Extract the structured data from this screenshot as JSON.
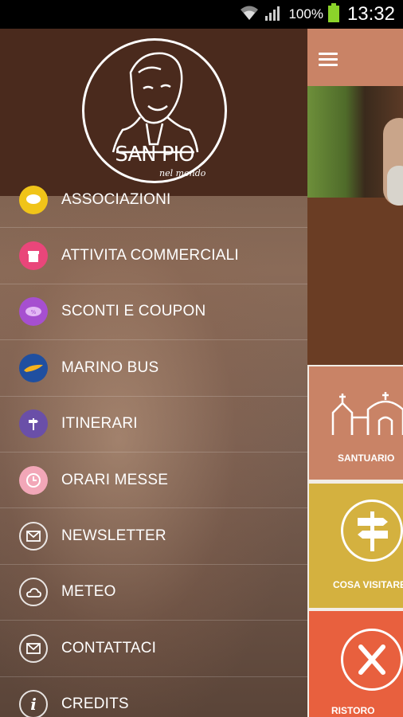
{
  "status_bar": {
    "battery_pct": "100%",
    "time": "13:32",
    "icons": [
      "wifi-icon",
      "signal-icon",
      "battery-icon"
    ]
  },
  "drawer": {
    "logo": {
      "title": "SAN PIO",
      "subtitle": "nel mondo"
    },
    "items": [
      {
        "label": "ASSOCIAZIONI",
        "icon": "chat-bubble-icon",
        "color": "#f0c419"
      },
      {
        "label": "ATTIVITA COMMERCIALI",
        "icon": "shop-icon",
        "color": "#e9467a"
      },
      {
        "label": "SCONTI E COUPON",
        "icon": "coupon-icon",
        "color": "#a64fd0"
      },
      {
        "label": "MARINO BUS",
        "icon": "bus-icon",
        "color": "#1f4fa0"
      },
      {
        "label": "ITINERARI",
        "icon": "signpost-icon",
        "color": "#6a4fa8"
      },
      {
        "label": "ORARI MESSE",
        "icon": "clock-icon",
        "color": "#f2a7b8"
      },
      {
        "label": "NEWSLETTER",
        "icon": "mail-icon",
        "color": "#ffffff"
      },
      {
        "label": "METEO",
        "icon": "weather-icon",
        "color": "#ffffff"
      },
      {
        "label": "CONTATTACI",
        "icon": "envelope-icon",
        "color": "#ffffff"
      },
      {
        "label": "CREDITS",
        "icon": "info-icon",
        "color": "#ffffff"
      }
    ]
  },
  "main": {
    "tiles": [
      {
        "label": "SANTUARIO",
        "color": "#c98366"
      },
      {
        "label": "COSA VISITARE",
        "color": "#d4b13f"
      },
      {
        "label": "RISTORO",
        "color": "#e8603e"
      }
    ]
  }
}
